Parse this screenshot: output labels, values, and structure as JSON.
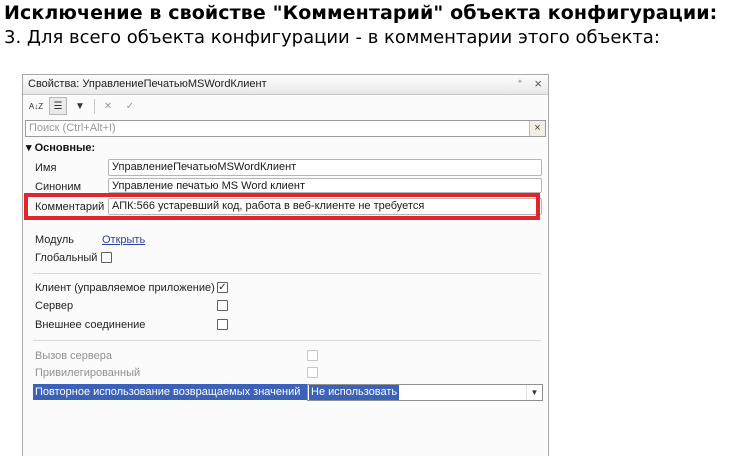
{
  "doc": {
    "heading": "Исключение в свойстве \"Комментарий\" объекта конфигурации:",
    "subheading": "3. Для всего объекта конфигурации - в комментарии этого объекта:"
  },
  "window": {
    "title": "Свойства: УправлениеПечатьюMSWordКлиент",
    "pin": "ᐩ",
    "close": "×"
  },
  "toolbar": {
    "sort_label": "A↓Z",
    "categories_label": "☰",
    "filter_label": "▼",
    "delete_label": "✕",
    "apply_label": "✓"
  },
  "search": {
    "placeholder": "Поиск (Ctrl+Alt+I)",
    "clear": "×"
  },
  "section": {
    "title": "▾ Основные:"
  },
  "properties": {
    "name_label": "Имя",
    "name_value": "УправлениеПечатьюMSWordКлиент",
    "synonym_label": "Синоним",
    "synonym_value": "Управление печатью MS Word клиент",
    "comment_label": "Комментарий",
    "comment_value": "АПК:566 устаревший код, работа в веб-клиенте не требуется",
    "module_label": "Модуль",
    "module_link": "Открыть",
    "global_label": "Глобальный",
    "client_label": "Клиент (управляемое приложение)",
    "client_check": "✓",
    "server_label": "Сервер",
    "external_label": "Внешнее соединение",
    "server_call_label": "Вызов сервера",
    "privileged_label": "Привилегированный",
    "reuse_label": "Повторное использование возвращаемых значений",
    "reuse_value": "Не использовать",
    "combo_arrow": "▼"
  },
  "colors": {
    "highlight": "#e1252b",
    "selection": "#3b62b8",
    "link": "#2c3f9c"
  }
}
